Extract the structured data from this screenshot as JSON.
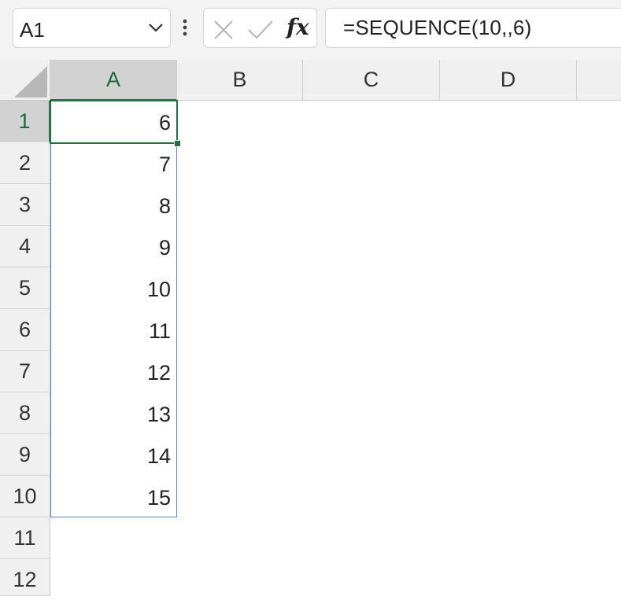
{
  "name_box": {
    "value": "A1"
  },
  "formula_bar": {
    "formula": "=SEQUENCE(10,,6)",
    "fx_label": "fx"
  },
  "columns": [
    "A",
    "B",
    "C",
    "D"
  ],
  "rows": [
    "1",
    "2",
    "3",
    "4",
    "5",
    "6",
    "7",
    "8",
    "9",
    "10",
    "11",
    "12"
  ],
  "column_a_values": [
    "6",
    "7",
    "8",
    "9",
    "10",
    "11",
    "12",
    "13",
    "14",
    "15"
  ],
  "colors": {
    "accent": "#217346",
    "spill_border": "#5b7fd6"
  },
  "selected_cell": "A1"
}
